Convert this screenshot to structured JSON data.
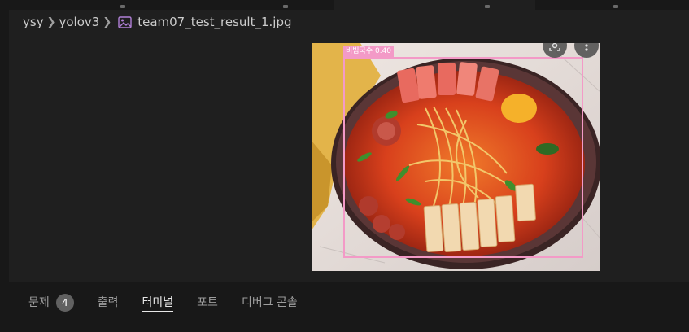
{
  "breadcrumb": {
    "items": [
      "ysy",
      "yolov3"
    ],
    "file_name": "team07_test_result_1.jpg",
    "file_icon": "image-file-icon"
  },
  "viewer": {
    "detection": {
      "label": "비빔국수 0.40",
      "box_color": "#f39ac7"
    },
    "buttons": [
      "image-search-icon",
      "more-vertical-icon"
    ]
  },
  "panel": {
    "tabs": [
      {
        "label": "문제",
        "badge": "4"
      },
      {
        "label": "출력"
      },
      {
        "label": "터미널",
        "active": true
      },
      {
        "label": "포트"
      },
      {
        "label": "디버그 콘솔"
      }
    ]
  },
  "colors": {
    "background": "#1f1f1f",
    "panel": "#181818",
    "accent_box": "#f39ac7"
  }
}
